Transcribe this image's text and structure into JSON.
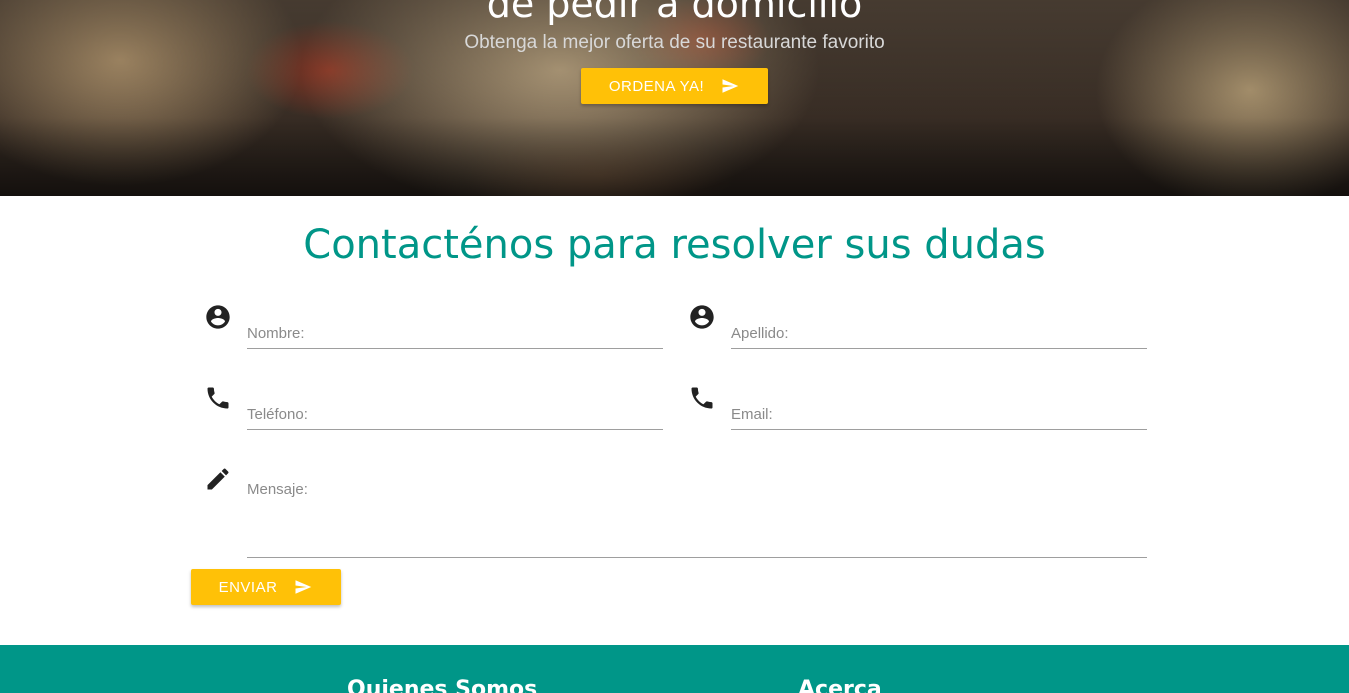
{
  "hero": {
    "title": "de pedir a domicilio",
    "subtitle": "Obtenga la mejor oferta de su restaurante favorito",
    "order_button_label": "ORDENA YA!",
    "order_button_icon": "send-icon",
    "accent_color": "#ffc107"
  },
  "contact": {
    "title": "Contacténos para resolver sus dudas",
    "title_color": "#009688",
    "fields": {
      "nombre": {
        "placeholder": "Nombre:",
        "value": "",
        "icon": "account-circle-icon"
      },
      "apellido": {
        "placeholder": "Apellido:",
        "value": "",
        "icon": "account-circle-icon"
      },
      "telefono": {
        "placeholder": "Teléfono:",
        "value": "",
        "icon": "phone-icon"
      },
      "email": {
        "placeholder": "Email:",
        "value": "",
        "icon": "phone-icon"
      },
      "mensaje": {
        "placeholder": "Mensaje:",
        "value": "",
        "icon": "pencil-icon"
      }
    },
    "send_button_label": "ENVIAR",
    "send_button_icon": "send-icon"
  },
  "footer": {
    "background_color": "#009688",
    "headings": [
      "Quienes Somos",
      "Acerca"
    ]
  }
}
